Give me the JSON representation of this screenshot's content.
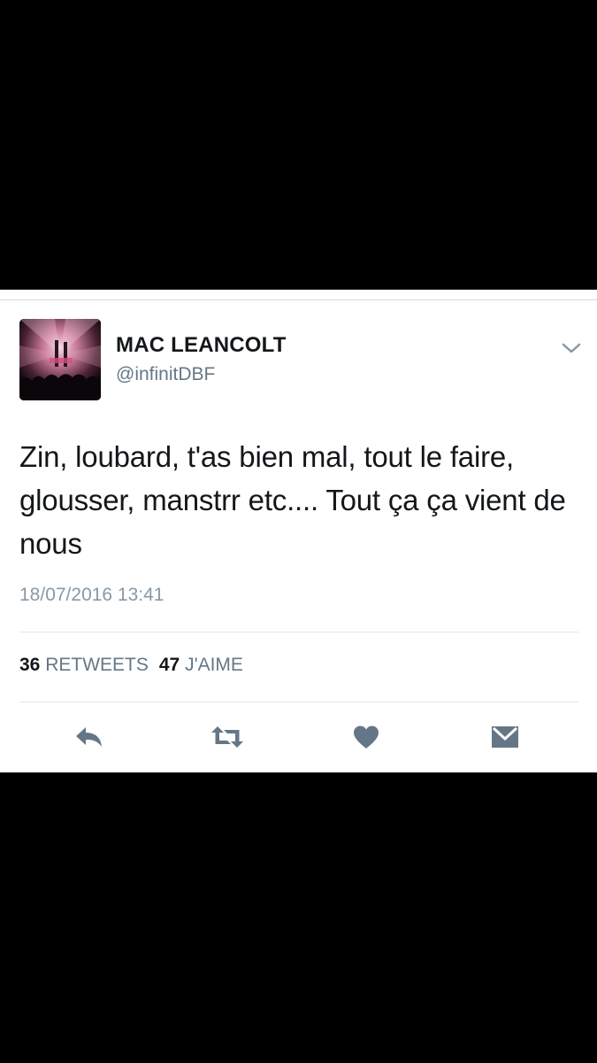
{
  "tweet": {
    "display_name": "MAC LEANCOLT",
    "handle": "@infinitDBF",
    "text": "Zin, loubard, t'as bien mal, tout le faire, glousser, manstrr etc.... Tout ça ça vient de nous",
    "timestamp": "18/07/2016 13:41",
    "retweets_count": "36",
    "retweets_label": "RETWEETS",
    "likes_count": "47",
    "likes_label": "J'AIME"
  },
  "icons": {
    "caret": "chevron-down-icon",
    "reply": "reply-icon",
    "retweet": "retweet-icon",
    "like": "heart-icon",
    "dm": "envelope-icon"
  },
  "colors": {
    "icon": "#657786",
    "text_primary": "#14171a",
    "text_secondary": "#657786",
    "timestamp": "#8899a6",
    "divider": "#e1e8ed"
  }
}
